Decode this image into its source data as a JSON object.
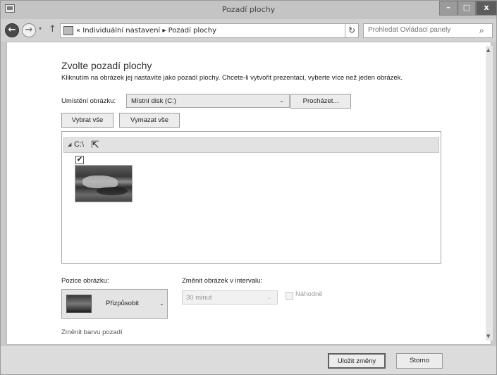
{
  "window": {
    "title": "Pozadí plochy"
  },
  "address": {
    "path": "« Individuální nastavení ▸ Pozadí plochy",
    "search_placeholder": "Prohledat Ovládací panely"
  },
  "page": {
    "heading": "Zvolte pozadí plochy",
    "subtitle": "Kliknutím na obrázek jej nastavíte jako pozadí plochy. Chcete-li vytvořit prezentaci, vyberte více než jeden obrázek.",
    "location_label": "Umístění obrázku:",
    "location_value": "Místní disk (C:)",
    "browse_label": "Procházet...",
    "select_all_label": "Vybrat vše",
    "clear_all_label": "Vymazat vše"
  },
  "pictures": {
    "group_label": "C:\\",
    "items": [
      {
        "checked": true
      }
    ]
  },
  "position": {
    "label": "Pozice obrázku:",
    "value": "Přizpůsobit"
  },
  "interval": {
    "label": "Změnit obrázek v intervalu:",
    "value": "30 minut",
    "shuffle_label": "Náhodně"
  },
  "color_link": "Změnit barvu pozadí",
  "footer": {
    "save_label": "Uložit změny",
    "cancel_label": "Storno"
  },
  "icons": {
    "back": "back-arrow-icon",
    "forward": "forward-arrow-icon",
    "up": "up-arrow-icon",
    "refresh": "refresh-icon",
    "search": "search-icon",
    "check": "✔"
  }
}
